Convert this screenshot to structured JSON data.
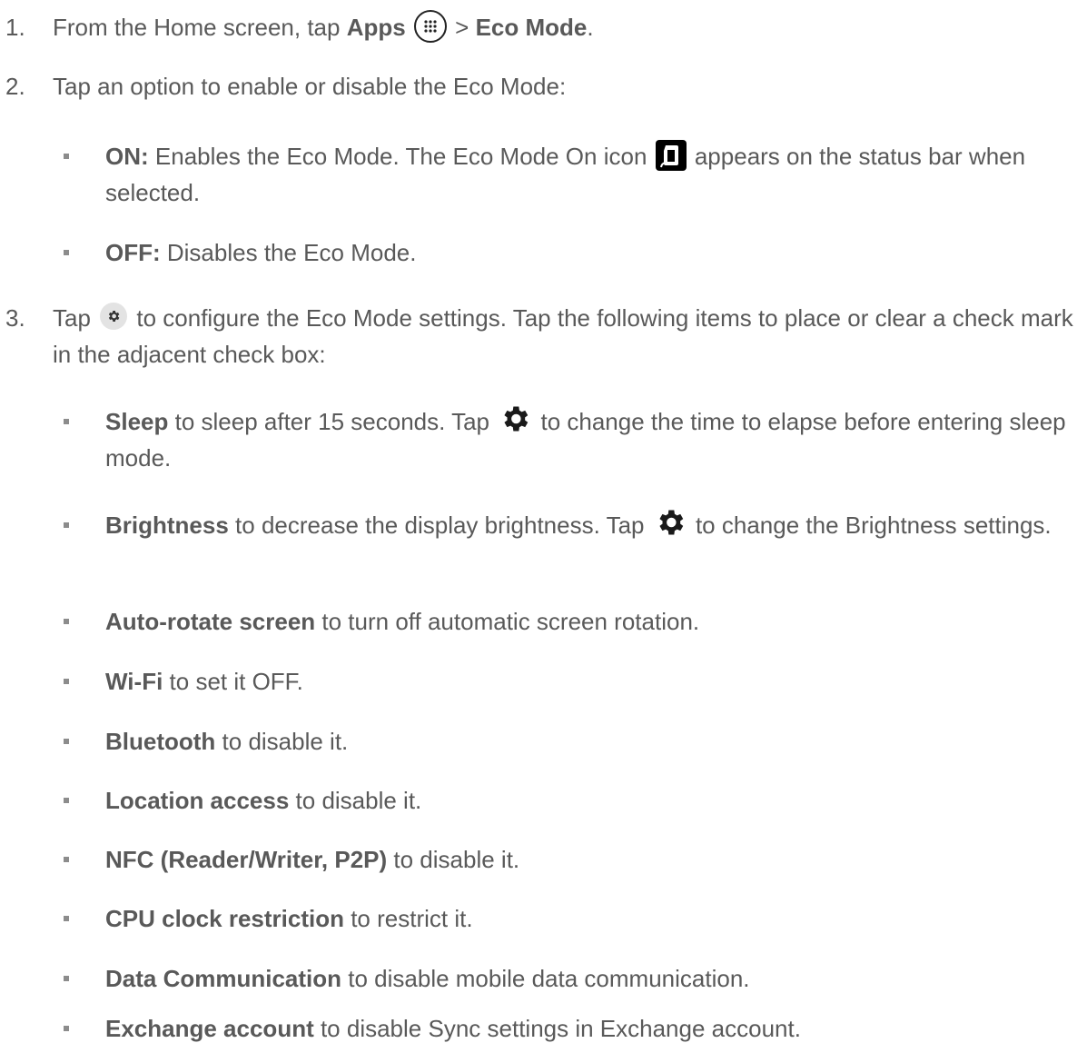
{
  "steps": [
    {
      "number": "1.",
      "pre": "From the Home screen, tap ",
      "apps": "Apps",
      "mid": " > ",
      "eco_mode": "Eco Mode",
      "post": "."
    },
    {
      "number": "2.",
      "text": "Tap an option to enable or disable the Eco Mode:",
      "bullets": [
        {
          "term": "ON:",
          "text_pre": " Enables the Eco Mode. The Eco Mode On icon ",
          "text_post": " appears on the status bar when selected."
        },
        {
          "term": "OFF:",
          "text": " Disables the Eco Mode."
        }
      ]
    },
    {
      "number": "3.",
      "pre": "Tap ",
      "post": " to configure the Eco Mode settings. Tap the following items to place or clear a check mark in the adjacent check box:",
      "bullets": [
        {
          "term": "Sleep",
          "text_pre": " to sleep after 15 seconds. Tap ",
          "text_post": " to change the time to elapse before entering sleep mode."
        },
        {
          "term": "Brightness",
          "text_pre": " to decrease the display brightness. Tap ",
          "text_post": " to change the Brightness settings."
        },
        {
          "term": "Auto-rotate screen",
          "text": " to turn off automatic screen rotation."
        },
        {
          "term": "Wi-Fi",
          "text": " to set it OFF."
        },
        {
          "term": "Bluetooth",
          "text": " to disable it."
        },
        {
          "term": "Location access",
          "text": " to disable it."
        },
        {
          "term": "NFC (Reader/Writer, P2P)",
          "text": " to disable it."
        },
        {
          "term": "CPU clock restriction",
          "text": " to restrict it."
        },
        {
          "term": "Data Communication",
          "text": " to disable mobile data communication."
        },
        {
          "term": "Exchange account",
          "text": " to disable Sync settings in Exchange account."
        }
      ]
    }
  ],
  "icons": {
    "apps": "apps-grid-icon",
    "eco_mode_on": "eco-mode-on-icon",
    "settings_small": "gear-icon",
    "settings_large": "gear-icon"
  },
  "colors": {
    "text": "#595959",
    "bullet": "#8c8c8c",
    "icon_dark": "#222222"
  }
}
